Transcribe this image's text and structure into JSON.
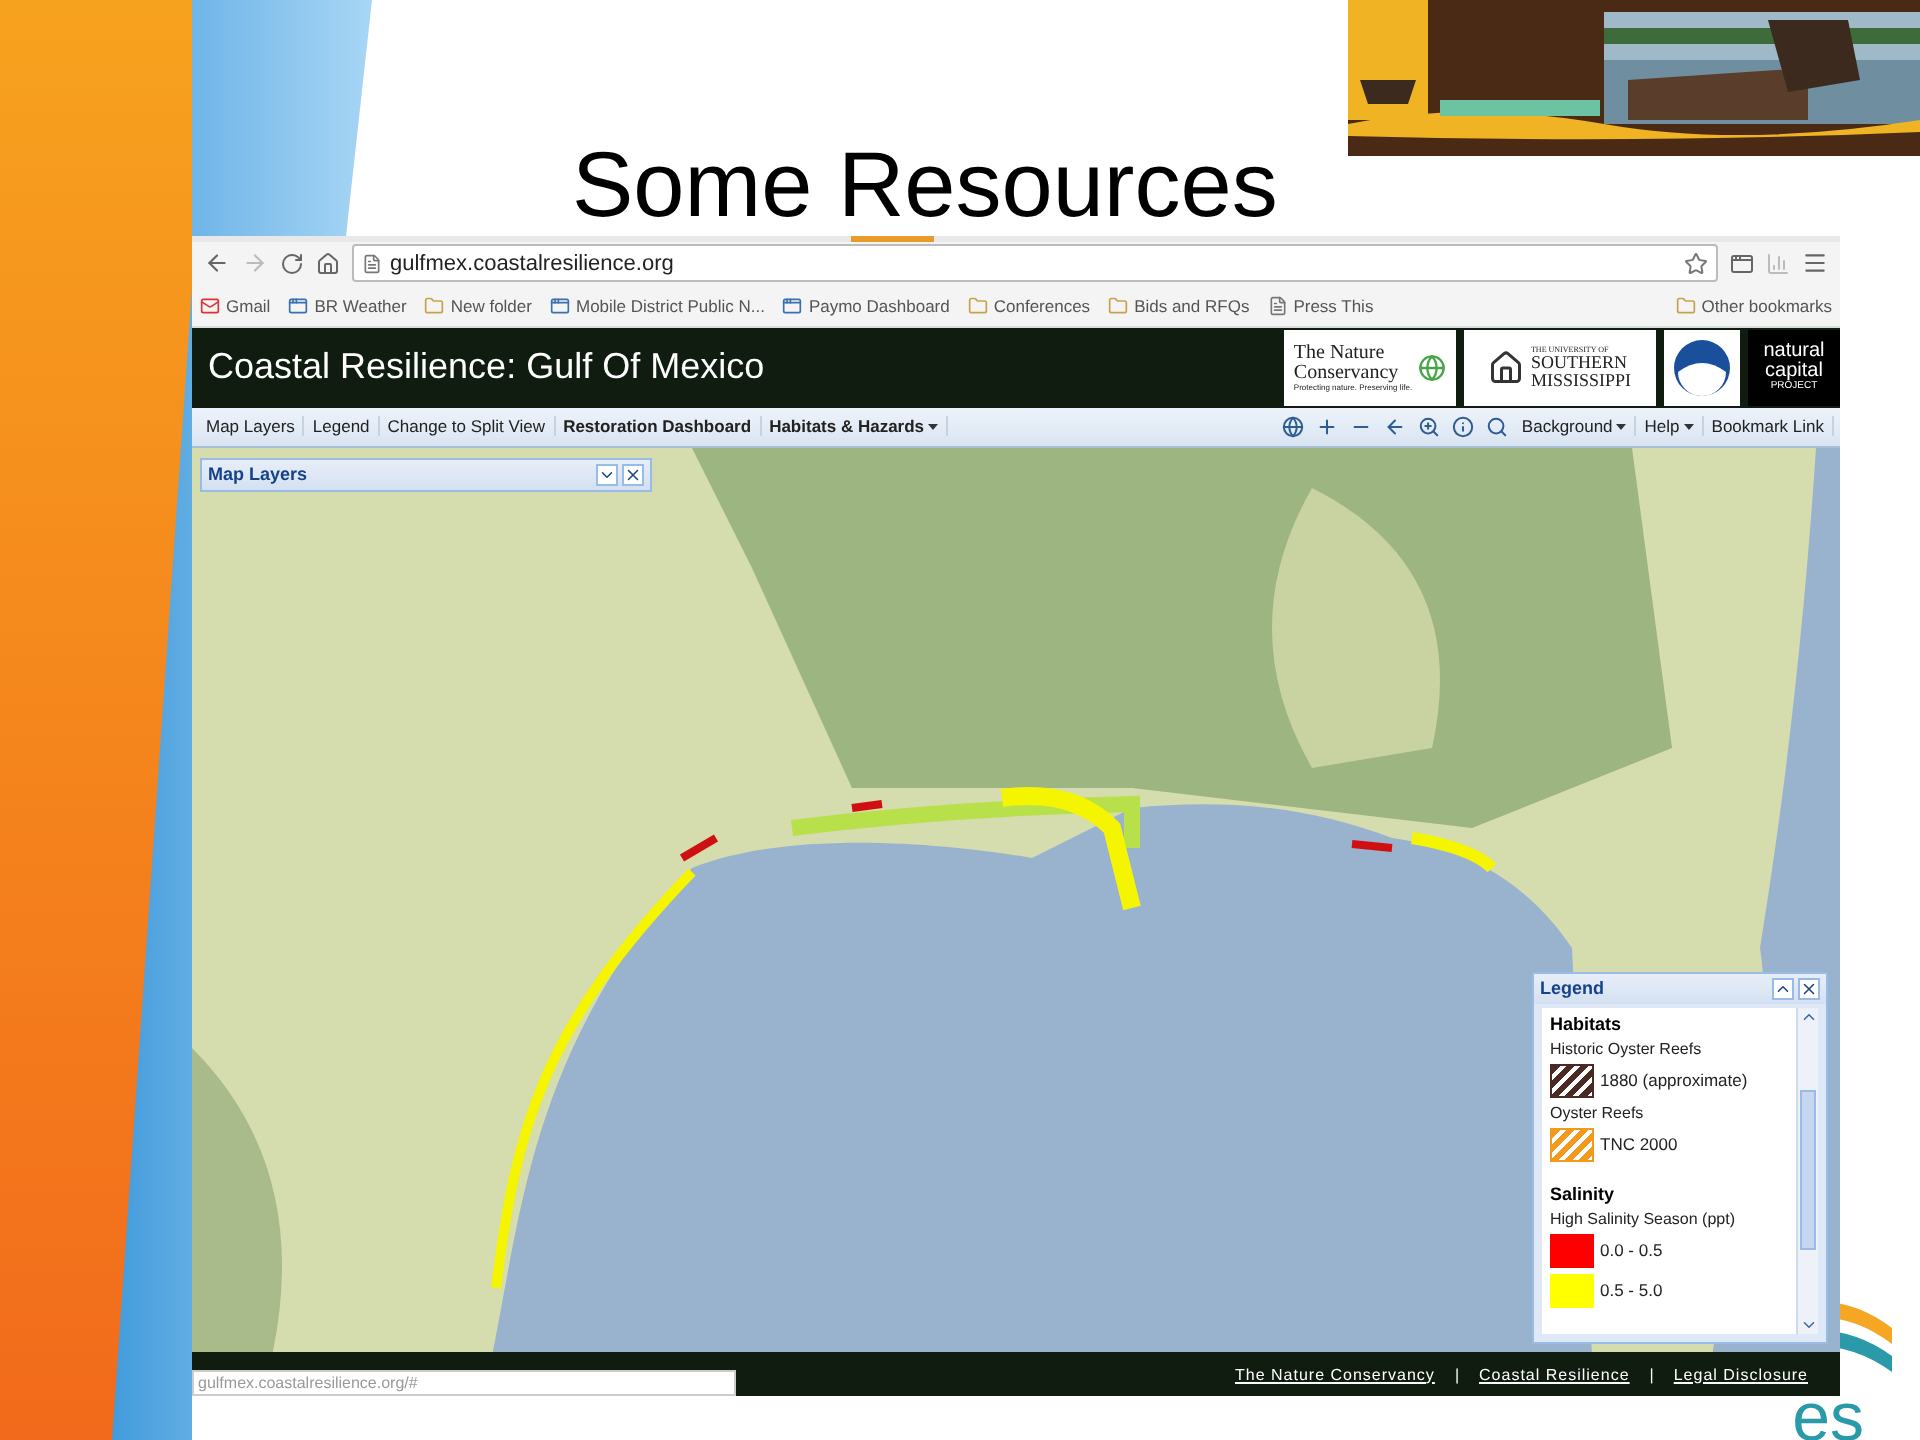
{
  "slide": {
    "title": "Some Resources",
    "corner_logo": {
      "text": "es"
    }
  },
  "browser": {
    "url": "gulfmex.coastalresilience.org",
    "bookmarks": [
      {
        "label": "Gmail",
        "kind": "mail"
      },
      {
        "label": "BR Weather",
        "kind": "app"
      },
      {
        "label": "New folder",
        "kind": "folder"
      },
      {
        "label": "Mobile District Public N...",
        "kind": "app"
      },
      {
        "label": "Paymo Dashboard",
        "kind": "app"
      },
      {
        "label": "Conferences",
        "kind": "folder"
      },
      {
        "label": "Bids and RFQs",
        "kind": "folder"
      },
      {
        "label": "Press This",
        "kind": "page"
      }
    ],
    "other_bookmarks": "Other bookmarks",
    "status_url": "gulfmex.coastalresilience.org/#"
  },
  "app": {
    "title": "Coastal Resilience: Gulf Of Mexico",
    "logos": {
      "tnc": [
        "The Nature",
        "Conservancy",
        "Protecting nature. Preserving life."
      ],
      "usm": [
        "THE UNIVERSITY OF",
        "SOUTHERN",
        "MISSISSIPPI"
      ],
      "ncp": [
        "natural",
        "capital",
        "PROJECT"
      ]
    },
    "toolbar_left": [
      {
        "label": "Map Layers",
        "bold": false,
        "dropdown": false
      },
      {
        "label": "Legend",
        "bold": false,
        "dropdown": false
      },
      {
        "label": "Change to Split View",
        "bold": false,
        "dropdown": false
      },
      {
        "label": "Restoration Dashboard",
        "bold": true,
        "dropdown": false
      },
      {
        "label": "Habitats & Hazards",
        "bold": true,
        "dropdown": true
      }
    ],
    "tools": [
      {
        "kind": "globe"
      },
      {
        "kind": "zoom-in"
      },
      {
        "kind": "zoom-out"
      },
      {
        "kind": "back"
      },
      {
        "kind": "zoom-box"
      },
      {
        "kind": "info"
      },
      {
        "kind": "search"
      }
    ],
    "toolbar_right": [
      {
        "label": "Background",
        "dropdown": true
      },
      {
        "label": "Help",
        "dropdown": true
      },
      {
        "label": "Bookmark Link",
        "dropdown": false
      }
    ],
    "map_layers_panel": {
      "title": "Map Layers"
    },
    "legend": {
      "title": "Legend",
      "sections": [
        {
          "heading": "Habitats",
          "groups": [
            {
              "label": "Historic Oyster Reefs",
              "items": [
                {
                  "label": "1880 (approximate)",
                  "kind": "hatched",
                  "color": "#4a2a22"
                }
              ]
            },
            {
              "label": "Oyster Reefs",
              "items": [
                {
                  "label": "TNC 2000",
                  "kind": "hatched",
                  "color": "#f39a1e"
                }
              ]
            }
          ]
        },
        {
          "heading": "Salinity",
          "groups": [
            {
              "label": "High Salinity Season (ppt)",
              "items": [
                {
                  "label": "0.0 - 0.5",
                  "kind": "solid",
                  "color": "#ff0000"
                },
                {
                  "label": "0.5 - 5.0",
                  "kind": "solid",
                  "color": "#ffff00"
                }
              ]
            }
          ]
        }
      ]
    },
    "footer_links": [
      "The Nature Conservancy",
      "Coastal Resilience",
      "Legal Disclosure"
    ],
    "footer_separator": "|"
  }
}
